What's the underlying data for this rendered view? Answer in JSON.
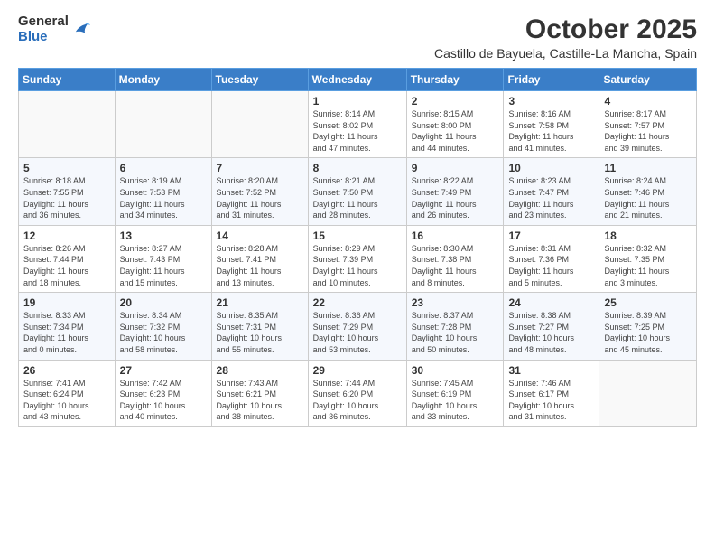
{
  "logo": {
    "general": "General",
    "blue": "Blue"
  },
  "title": "October 2025",
  "subtitle": "Castillo de Bayuela, Castille-La Mancha, Spain",
  "headers": [
    "Sunday",
    "Monday",
    "Tuesday",
    "Wednesday",
    "Thursday",
    "Friday",
    "Saturday"
  ],
  "weeks": [
    [
      {
        "day": "",
        "info": ""
      },
      {
        "day": "",
        "info": ""
      },
      {
        "day": "",
        "info": ""
      },
      {
        "day": "1",
        "info": "Sunrise: 8:14 AM\nSunset: 8:02 PM\nDaylight: 11 hours\nand 47 minutes."
      },
      {
        "day": "2",
        "info": "Sunrise: 8:15 AM\nSunset: 8:00 PM\nDaylight: 11 hours\nand 44 minutes."
      },
      {
        "day": "3",
        "info": "Sunrise: 8:16 AM\nSunset: 7:58 PM\nDaylight: 11 hours\nand 41 minutes."
      },
      {
        "day": "4",
        "info": "Sunrise: 8:17 AM\nSunset: 7:57 PM\nDaylight: 11 hours\nand 39 minutes."
      }
    ],
    [
      {
        "day": "5",
        "info": "Sunrise: 8:18 AM\nSunset: 7:55 PM\nDaylight: 11 hours\nand 36 minutes."
      },
      {
        "day": "6",
        "info": "Sunrise: 8:19 AM\nSunset: 7:53 PM\nDaylight: 11 hours\nand 34 minutes."
      },
      {
        "day": "7",
        "info": "Sunrise: 8:20 AM\nSunset: 7:52 PM\nDaylight: 11 hours\nand 31 minutes."
      },
      {
        "day": "8",
        "info": "Sunrise: 8:21 AM\nSunset: 7:50 PM\nDaylight: 11 hours\nand 28 minutes."
      },
      {
        "day": "9",
        "info": "Sunrise: 8:22 AM\nSunset: 7:49 PM\nDaylight: 11 hours\nand 26 minutes."
      },
      {
        "day": "10",
        "info": "Sunrise: 8:23 AM\nSunset: 7:47 PM\nDaylight: 11 hours\nand 23 minutes."
      },
      {
        "day": "11",
        "info": "Sunrise: 8:24 AM\nSunset: 7:46 PM\nDaylight: 11 hours\nand 21 minutes."
      }
    ],
    [
      {
        "day": "12",
        "info": "Sunrise: 8:26 AM\nSunset: 7:44 PM\nDaylight: 11 hours\nand 18 minutes."
      },
      {
        "day": "13",
        "info": "Sunrise: 8:27 AM\nSunset: 7:43 PM\nDaylight: 11 hours\nand 15 minutes."
      },
      {
        "day": "14",
        "info": "Sunrise: 8:28 AM\nSunset: 7:41 PM\nDaylight: 11 hours\nand 13 minutes."
      },
      {
        "day": "15",
        "info": "Sunrise: 8:29 AM\nSunset: 7:39 PM\nDaylight: 11 hours\nand 10 minutes."
      },
      {
        "day": "16",
        "info": "Sunrise: 8:30 AM\nSunset: 7:38 PM\nDaylight: 11 hours\nand 8 minutes."
      },
      {
        "day": "17",
        "info": "Sunrise: 8:31 AM\nSunset: 7:36 PM\nDaylight: 11 hours\nand 5 minutes."
      },
      {
        "day": "18",
        "info": "Sunrise: 8:32 AM\nSunset: 7:35 PM\nDaylight: 11 hours\nand 3 minutes."
      }
    ],
    [
      {
        "day": "19",
        "info": "Sunrise: 8:33 AM\nSunset: 7:34 PM\nDaylight: 11 hours\nand 0 minutes."
      },
      {
        "day": "20",
        "info": "Sunrise: 8:34 AM\nSunset: 7:32 PM\nDaylight: 10 hours\nand 58 minutes."
      },
      {
        "day": "21",
        "info": "Sunrise: 8:35 AM\nSunset: 7:31 PM\nDaylight: 10 hours\nand 55 minutes."
      },
      {
        "day": "22",
        "info": "Sunrise: 8:36 AM\nSunset: 7:29 PM\nDaylight: 10 hours\nand 53 minutes."
      },
      {
        "day": "23",
        "info": "Sunrise: 8:37 AM\nSunset: 7:28 PM\nDaylight: 10 hours\nand 50 minutes."
      },
      {
        "day": "24",
        "info": "Sunrise: 8:38 AM\nSunset: 7:27 PM\nDaylight: 10 hours\nand 48 minutes."
      },
      {
        "day": "25",
        "info": "Sunrise: 8:39 AM\nSunset: 7:25 PM\nDaylight: 10 hours\nand 45 minutes."
      }
    ],
    [
      {
        "day": "26",
        "info": "Sunrise: 7:41 AM\nSunset: 6:24 PM\nDaylight: 10 hours\nand 43 minutes."
      },
      {
        "day": "27",
        "info": "Sunrise: 7:42 AM\nSunset: 6:23 PM\nDaylight: 10 hours\nand 40 minutes."
      },
      {
        "day": "28",
        "info": "Sunrise: 7:43 AM\nSunset: 6:21 PM\nDaylight: 10 hours\nand 38 minutes."
      },
      {
        "day": "29",
        "info": "Sunrise: 7:44 AM\nSunset: 6:20 PM\nDaylight: 10 hours\nand 36 minutes."
      },
      {
        "day": "30",
        "info": "Sunrise: 7:45 AM\nSunset: 6:19 PM\nDaylight: 10 hours\nand 33 minutes."
      },
      {
        "day": "31",
        "info": "Sunrise: 7:46 AM\nSunset: 6:17 PM\nDaylight: 10 hours\nand 31 minutes."
      },
      {
        "day": "",
        "info": ""
      }
    ]
  ]
}
